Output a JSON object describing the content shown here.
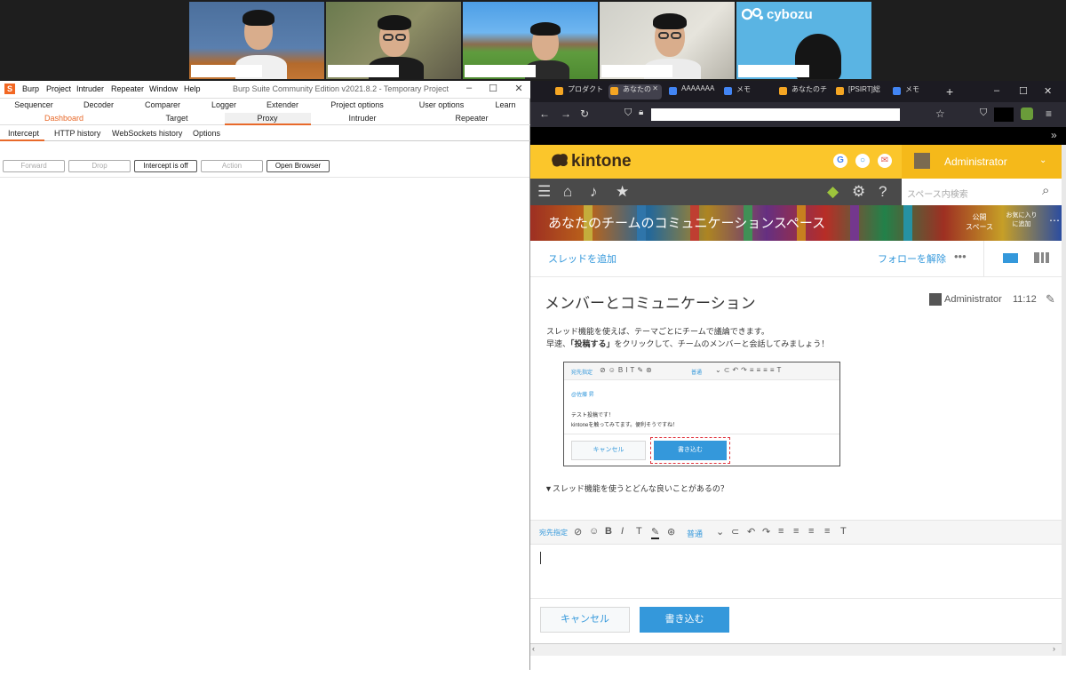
{
  "video": {
    "logo_text": "cybozu"
  },
  "burp": {
    "menu": [
      "Burp",
      "Project",
      "Intruder",
      "Repeater",
      "Window",
      "Help"
    ],
    "title": "Burp Suite Community Edition v2021.8.2 - Temporary Project",
    "tabs_row1": [
      "Sequencer",
      "Decoder",
      "Comparer",
      "Logger",
      "Extender",
      "Project options",
      "User options",
      "Learn"
    ],
    "tabs_row2": [
      "Dashboard",
      "Target",
      "Proxy",
      "Intruder",
      "Repeater"
    ],
    "subtabs": [
      "Intercept",
      "HTTP history",
      "WebSockets history",
      "Options"
    ],
    "controls": [
      "Forward",
      "Drop",
      "Intercept is off",
      "Action",
      "Open Browser"
    ],
    "accent": "#e8692a"
  },
  "firefox": {
    "tabs": [
      {
        "label": "プロダクトセ",
        "color": "#f5a623"
      },
      {
        "label": "あなたの",
        "color": "#f5a623"
      },
      {
        "label": "AAAAAAA",
        "color": "#4285f4"
      },
      {
        "label": "メモ",
        "color": "#4285f4"
      },
      {
        "label": "あなたのチ",
        "color": "#f5a623"
      },
      {
        "label": "[PSIRT]総",
        "color": "#f5a623"
      },
      {
        "label": "メモ",
        "color": "#4285f4"
      }
    ]
  },
  "kintone": {
    "logo": "kintone",
    "user": "Administrator",
    "search_placeholder": "スペース内検索",
    "banner_title": "あなたのチームのコミュニケーションスペース",
    "banner_public": "公開\nスペース",
    "banner_fav": "お気に入り\nに追加",
    "add_thread": "スレッドを追加",
    "unfollow": "フォローを解除",
    "thread_title": "メンバーとコミュニケーション",
    "author": "Administrator",
    "time": "11:12",
    "body_line1": "スレッド機能を使えば、テーマごとにチームで議論できます。",
    "body_line2_pre": "早速、",
    "body_line2_bold": "「投稿する」",
    "body_line2_post": "をクリックして、チームのメンバーと会話してみましょう！",
    "sample": {
      "mention_label": "宛先指定",
      "font_size": "普通",
      "mention": "@佐藤 昇",
      "line1": "テスト投稿です！",
      "line2": "kintoneを触ってみてます。便利そうですね！",
      "cancel": "キャンセル",
      "write": "書き込む"
    },
    "faq": "▼スレッド機能を使うとどんな良いことがあるの？",
    "editor": {
      "mention_label": "宛先指定",
      "font_size": "普通"
    },
    "cancel": "キャンセル",
    "write": "書き込む",
    "brand_color": "#fbc62b",
    "link_color": "#3498db"
  }
}
